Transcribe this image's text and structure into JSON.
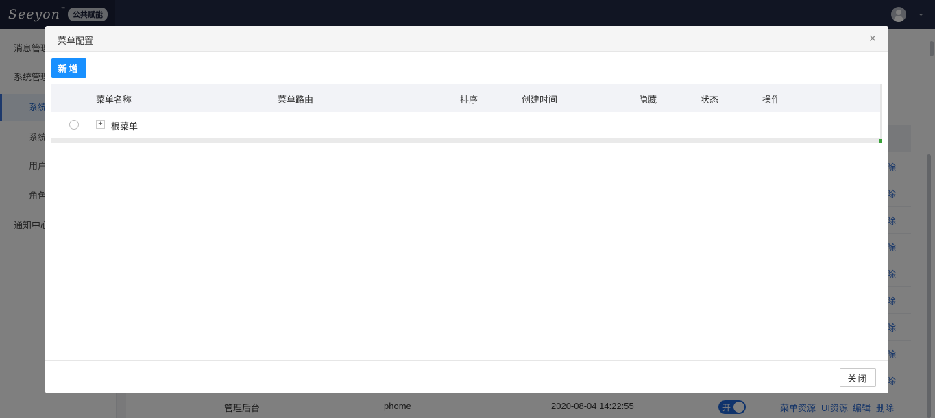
{
  "app": {
    "logo_text": "Seeyon",
    "logo_tm": "™",
    "logo_badge": "公共赋能"
  },
  "sidebar": {
    "items": [
      {
        "label": "消息管理"
      },
      {
        "label": "系统管理"
      },
      {
        "label": "系统"
      },
      {
        "label": "系统"
      },
      {
        "label": "用户"
      },
      {
        "label": "角色"
      },
      {
        "label": "通知中心"
      }
    ]
  },
  "background": {
    "row_action_tail": "除",
    "bottom_row": {
      "name": "管理后台",
      "code": "phome",
      "time": "2020-08-04 14:22:55",
      "toggle_label": "开",
      "actions": [
        "菜单资源",
        "UI资源",
        "编辑",
        "删除"
      ]
    }
  },
  "modal": {
    "title": "菜单配置",
    "close_icon": "×",
    "add_button": "新增",
    "columns": [
      "菜单名称",
      "菜单路由",
      "排序",
      "创建时间",
      "隐藏",
      "状态",
      "操作"
    ],
    "rows": [
      {
        "expander": "+",
        "name": "根菜单"
      }
    ],
    "footer_close": "关闭"
  },
  "colors": {
    "topbar": "#222b46",
    "primary": "#1890ff",
    "link": "#2d6bd1"
  }
}
